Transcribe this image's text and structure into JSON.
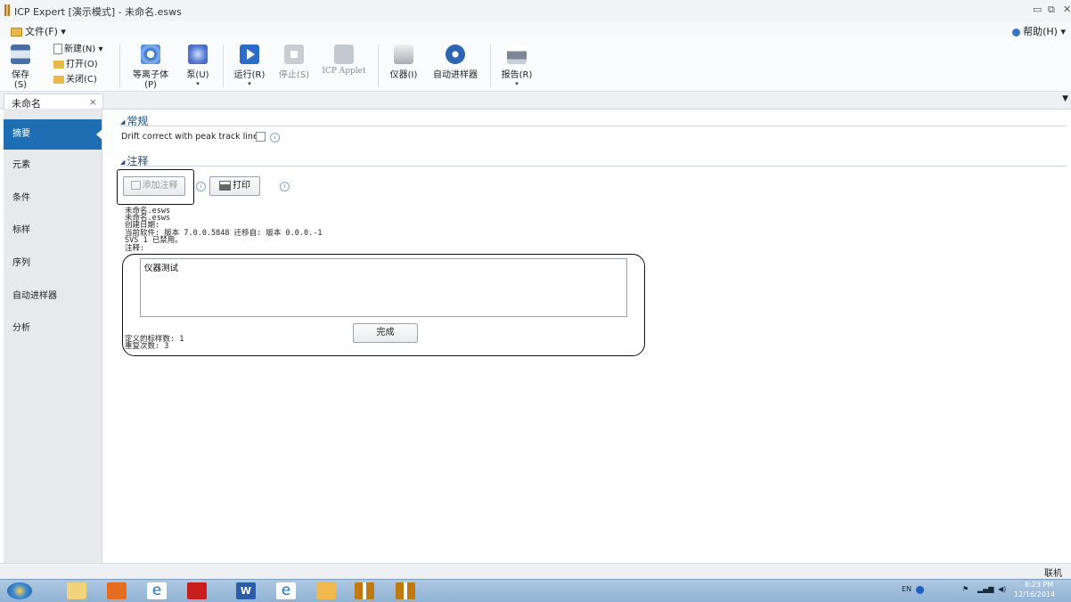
{
  "window": {
    "title": "ICP Expert [演示模式] - 未命名.esws",
    "min_icon": "minimize-icon",
    "restore_icon": "restore-icon",
    "close_icon": "close-icon"
  },
  "menubar": {
    "file": "文件(F)",
    "help": "帮助(H)"
  },
  "ribbon": {
    "save": "保存(S)",
    "new": "新建(N)",
    "open": "打开(O)",
    "close": "关闭(C)",
    "plasma": "等离子体(P)",
    "pump": "泵(U)",
    "run": "运行(R)",
    "stop": "停止(S)",
    "applet": "ICP Applet",
    "instrument": "仪器(I)",
    "autosampler": "自动进样器",
    "report": "报告(R)"
  },
  "doc_tab": {
    "label": "未命名",
    "close": "×"
  },
  "sidebar": {
    "items": [
      {
        "label": "摘要"
      },
      {
        "label": "元素"
      },
      {
        "label": "条件"
      },
      {
        "label": "标样"
      },
      {
        "label": "序列"
      },
      {
        "label": "自动进样器"
      },
      {
        "label": "分析"
      }
    ]
  },
  "general": {
    "heading": "常规",
    "drift_label": "Drift correct with peak track lines",
    "drift_checked": false
  },
  "notes": {
    "heading": "注释",
    "add_note": "添加注释",
    "print": "打印",
    "summary_lines": [
      "未命名.esws",
      "未命名.esws",
      "创建日期:",
      "当前软件: 版本 7.0.0.5848 迁移自: 版本 0.0.0.-1",
      "SVS 1 已禁用。",
      "注释:"
    ],
    "note_text": "仪器测试",
    "done": "完成",
    "std_count": "定义的标样数: 1",
    "repeat_count": "重复次数: 3"
  },
  "status": {
    "text": "联机"
  },
  "taskbar": {
    "lang": "EN",
    "time": "8:23 PM",
    "date": "12/16/2014"
  },
  "colors": {
    "accent": "#1d6eb2",
    "heading": "#1d4f85"
  }
}
